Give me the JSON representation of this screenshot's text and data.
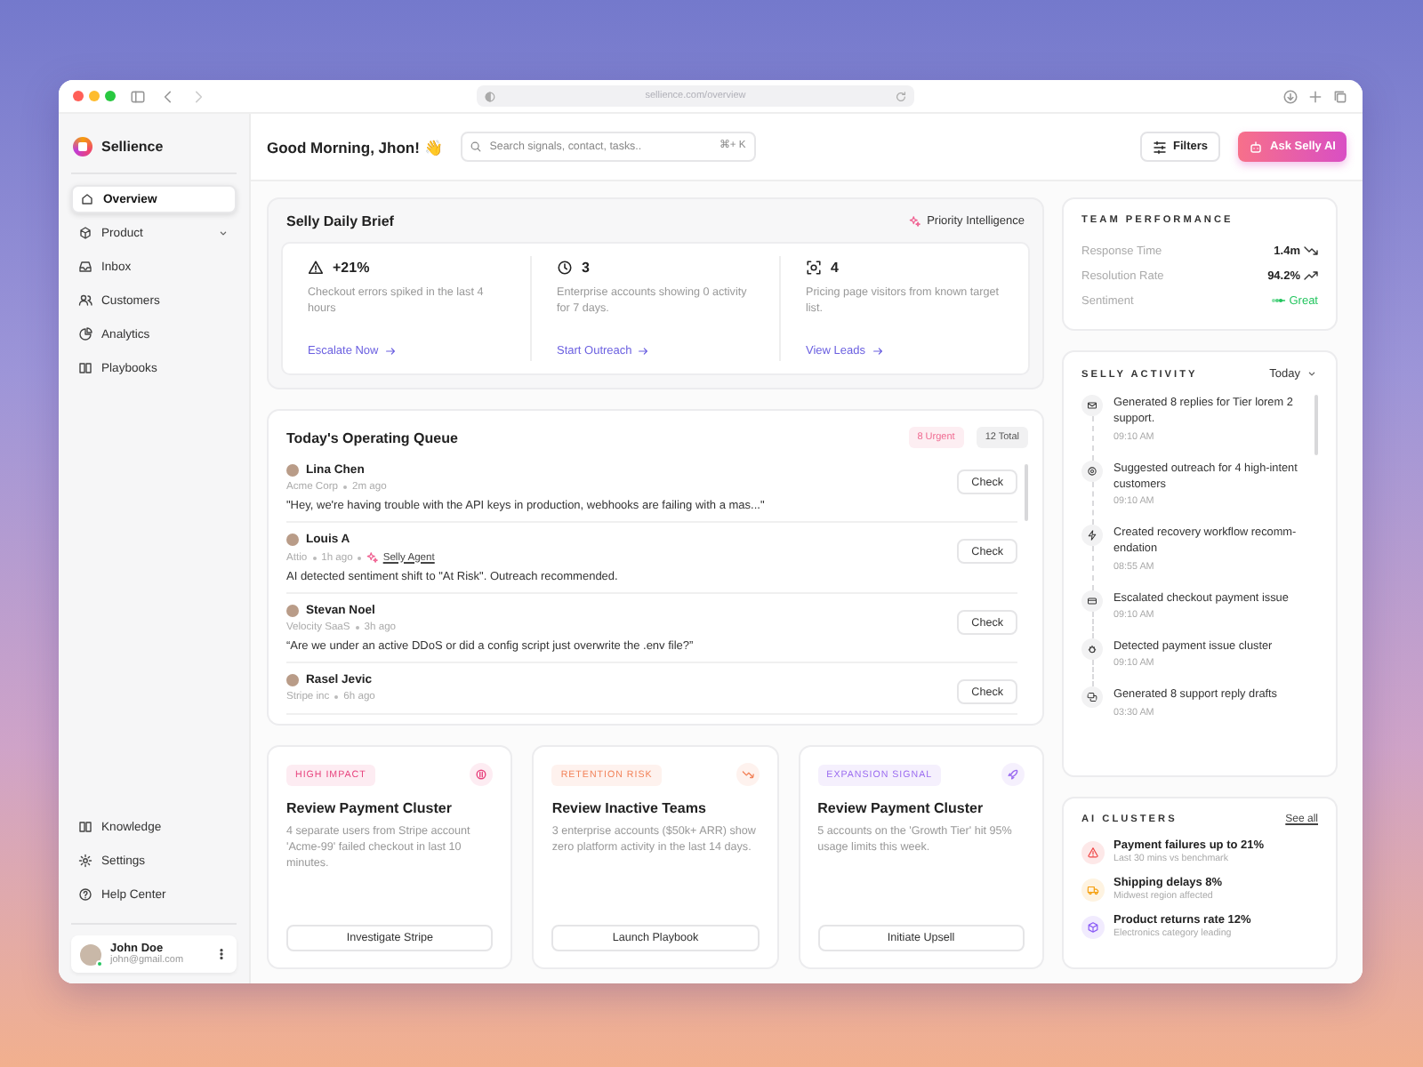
{
  "browser": {
    "url": "sellience.com/overview"
  },
  "sidebar": {
    "brand": "Sellience",
    "items": [
      {
        "label": "Overview",
        "selected": true,
        "expandable": false
      },
      {
        "label": "Product",
        "selected": false,
        "expandable": true
      },
      {
        "label": "Inbox",
        "selected": false,
        "expandable": false
      },
      {
        "label": "Customers",
        "selected": false,
        "expandable": false
      },
      {
        "label": "Analytics",
        "selected": false,
        "expandable": false
      },
      {
        "label": "Playbooks",
        "selected": false,
        "expandable": false
      }
    ],
    "bottom_items": [
      {
        "label": "Knowledge"
      },
      {
        "label": "Settings"
      },
      {
        "label": "Help Center"
      }
    ],
    "user": {
      "name": "John Doe",
      "email": "john@gmail.com",
      "online": true
    }
  },
  "header": {
    "greeting": "Good Morning, Jhon! 👋",
    "search": {
      "placeholder": "Search signals, contact, tasks..",
      "shortcut": "⌘+ K"
    },
    "buttons": [
      {
        "label": "Filters",
        "kind": "outline"
      },
      {
        "label": "Ask Selly AI",
        "kind": "primary"
      }
    ]
  },
  "brief": {
    "title": "Selly Daily Brief",
    "badge": "Priority Intelligence",
    "items": [
      {
        "value": "+21%",
        "text": "Checkout errors spiked in the last 4 hours",
        "link": "Escalate Now"
      },
      {
        "value": "3",
        "text": "Enterprise accounts showing 0 activity for 7 days.",
        "link": "Start Outreach"
      },
      {
        "value": "4",
        "text": "Pricing page visitors from known target list.",
        "link": "View Leads"
      }
    ]
  },
  "queue": {
    "title": "Today's Operating Queue",
    "urgent": "8 Urgent",
    "total": "12 Total",
    "rows": [
      {
        "name": "Lina Chen",
        "company": "Acme Corp",
        "time": "2m ago",
        "message": "\"Hey, we're having trouble with the API keys in production, webhooks are failing with a mas...\"",
        "button": "Check"
      },
      {
        "name": "Louis A",
        "company": "Attio",
        "time": "1h ago",
        "agent": "Selly Agent",
        "message": "AI detected sentiment shift to \"At Risk\". Outreach recommended.",
        "button": "Check"
      },
      {
        "name": "Stevan Noel",
        "company": "Velocity SaaS",
        "time": "3h ago",
        "message": "“Are we under an active DDoS or did a config script just overwrite the .env file?”",
        "button": "Check"
      },
      {
        "name": "Rasel Jevic",
        "company": "Stripe inc",
        "time": "6h ago",
        "button": "Check"
      }
    ]
  },
  "actions": [
    {
      "tag": "HIGH IMPACT",
      "color": "#e8457f",
      "title": "Review Payment Cluster",
      "text": "4 separate users from Stripe account 'Acme-99' failed checkout in last 10 minutes.",
      "button": "Investigate Stripe"
    },
    {
      "tag": "RETENTION RISK",
      "color": "#f2835a",
      "title": "Review Inactive Teams",
      "text": "3 enterprise accounts ($50k+ ARR) show zero platform activity in the last 14 days.",
      "button": "Launch Playbook"
    },
    {
      "tag": "EXPANSION SIGNAL",
      "color": "#9b6cf0",
      "title": "Review Payment Cluster",
      "text": "5 accounts on the 'Growth Tier' hit 95% usage limits this week.",
      "button": "Initiate Upsell"
    }
  ],
  "team_performance": {
    "title": "TEAM PERFORMANCE",
    "metrics": [
      {
        "label": "Response Time",
        "value": "1.4m",
        "kind": "trend-down"
      },
      {
        "label": "Resolution Rate",
        "value": "94.2%",
        "kind": "trend-up"
      },
      {
        "label": "Sentiment",
        "value": "Great",
        "kind": "status"
      }
    ]
  },
  "activity": {
    "title": "SELLY ACTIVITY",
    "filter": "Today",
    "items": [
      {
        "text": "Generated 8 replies for Tier lorem 2 support.",
        "time": "09:10 AM"
      },
      {
        "text": "Suggested outreach for 4 high-intent customers",
        "time": "09:10 AM"
      },
      {
        "text": "Created recovery workflow recomm-endation",
        "time": "08:55 AM"
      },
      {
        "text": "Escalated checkout payment issue",
        "time": "09:10 AM"
      },
      {
        "text": "Detected payment issue cluster",
        "time": "09:10 AM"
      },
      {
        "text": "Generated 8 support reply drafts",
        "time": "03:30 AM"
      }
    ]
  },
  "clusters": {
    "title": "AI CLUSTERS",
    "link": "See all",
    "items": [
      {
        "title": "Payment failures up to 21%",
        "subtitle": "Last 30 mins vs benchmark",
        "color": "#ef4444"
      },
      {
        "title": "Shipping delays 8%",
        "subtitle": "Midwest region affected",
        "color": "#f59e0b"
      },
      {
        "title": "Product returns rate 12%",
        "subtitle": "Electronics category leading",
        "color": "#8b5cf6"
      }
    ]
  }
}
